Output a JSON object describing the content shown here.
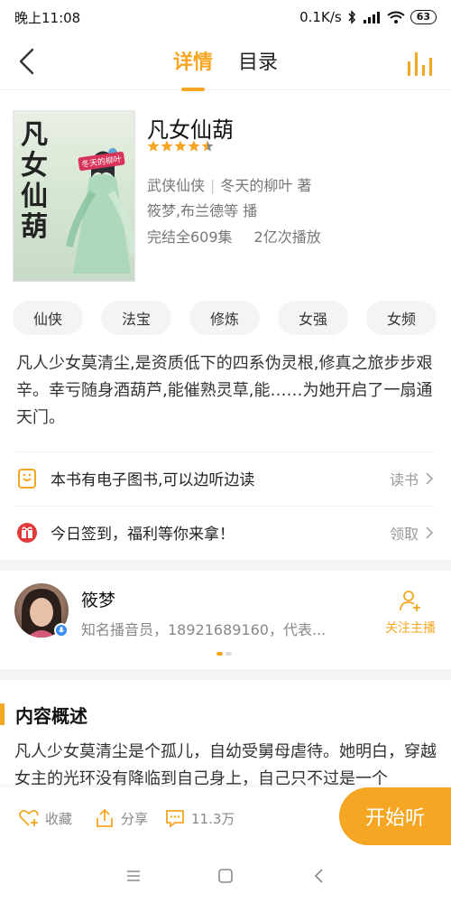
{
  "status": {
    "time": "晚上11:08",
    "network": "0.1K/s",
    "battery": "63"
  },
  "nav": {
    "tabs": [
      {
        "label": "详情",
        "active": true
      },
      {
        "label": "目录",
        "active": false
      }
    ]
  },
  "book": {
    "title": "凡女仙葫",
    "rating": 4.5,
    "cover_title": "凡女仙葫",
    "cover_badge": "冬天的柳叶",
    "genre": "武侠仙侠",
    "author": "冬天的柳叶",
    "author_suffix": "著",
    "narrators": "筱梦,布兰德等",
    "narrator_suffix": "播",
    "episodes": "完结全609集",
    "plays": "2亿次播放"
  },
  "tags": [
    "仙侠",
    "法宝",
    "修炼",
    "女强",
    "女频"
  ],
  "description": "凡人少女莫清尘,是资质低下的四系伪灵根,修真之旅步步艰辛。幸亏随身酒葫芦,能催熟灵草,能……为她开启了一扇通天门。",
  "rows": {
    "ebook": {
      "text": "本书有电子图书,可以边听边读",
      "action": "读书"
    },
    "checkin": {
      "text": "今日签到，福利等你来拿！",
      "action": "领取"
    }
  },
  "anchor": {
    "name": "筱梦",
    "desc": "知名播音员，18921689160，代表...",
    "follow_label": "关注主播"
  },
  "overview": {
    "title": "内容概述",
    "text": "凡人少女莫清尘是个孤儿，自幼受舅母虐待。她明白，穿越女主的光环没有降临到自己身上，自己只不过是一个"
  },
  "actions": {
    "collect": "收藏",
    "share": "分享",
    "comments": "11.3万",
    "play": "开始听"
  },
  "colors": {
    "accent": "#f5a623",
    "text": "#222222",
    "muted": "#888888"
  }
}
